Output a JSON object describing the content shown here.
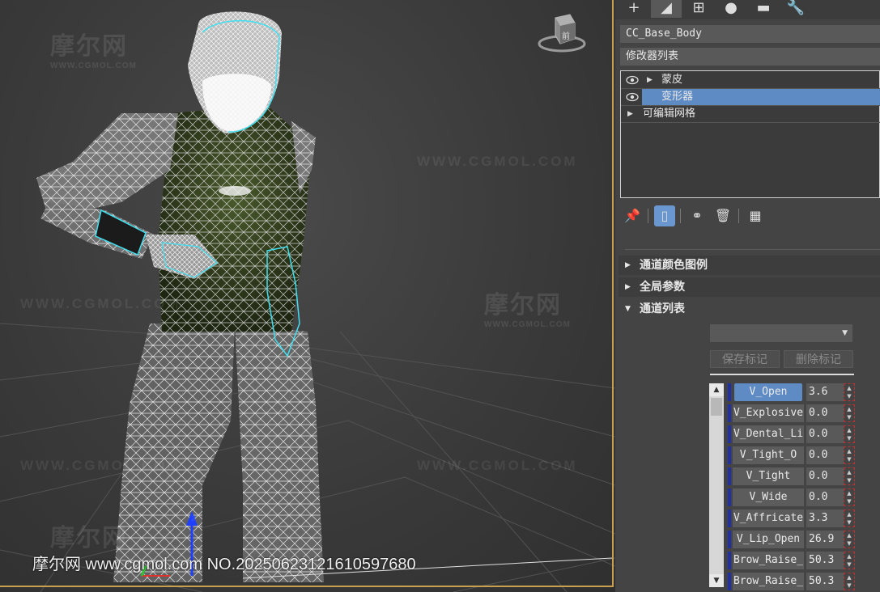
{
  "viewport": {
    "watermarks": [
      {
        "brand": "摩尔网",
        "sub": "WWW.CGMOL.COM"
      },
      {
        "brand": "摩尔网",
        "sub": "WWW.CGMOL.COM"
      },
      {
        "brand": "摩尔网",
        "sub": ""
      }
    ],
    "url_watermarks": [
      "WWW.CGMOL.COM",
      "WWW.CGMOL.COM",
      "WWW.CGMOL.COM",
      "WWW.CGMOL.COM"
    ],
    "footer_watermark": "摩尔网 www.cgmol.com NO.20250623121610597680",
    "viewcube_label": "前"
  },
  "panel": {
    "tabs": [
      {
        "icon": "create-icon",
        "glyph": "+"
      },
      {
        "icon": "modify-icon",
        "glyph": "◢"
      },
      {
        "icon": "hierarchy-icon",
        "glyph": "⊞"
      },
      {
        "icon": "motion-icon",
        "glyph": "●"
      },
      {
        "icon": "display-icon",
        "glyph": "▬"
      },
      {
        "icon": "utilities-icon",
        "glyph": "🔧"
      }
    ],
    "object_name": "CC_Base_Body",
    "modifier_list_label": "修改器列表",
    "stack": [
      {
        "label": "蒙皮",
        "eye": true,
        "expand": true,
        "selected": false
      },
      {
        "label": "变形器",
        "eye": true,
        "expand": false,
        "selected": true
      },
      {
        "label": "可编辑网格",
        "eye": false,
        "expand": true,
        "selected": false
      }
    ],
    "rollouts": [
      {
        "label": "通道颜色图例",
        "open": false
      },
      {
        "label": "全局参数",
        "open": false
      },
      {
        "label": "通道列表",
        "open": true
      }
    ],
    "dropdown_value": "",
    "save_marker_label": "保存标记",
    "delete_marker_label": "删除标记",
    "channels": [
      {
        "name": "V_Open",
        "value": "3.6",
        "selected": true
      },
      {
        "name": "V_Explosive",
        "value": "0.0",
        "selected": false
      },
      {
        "name": "V_Dental_Li",
        "value": "0.0",
        "selected": false
      },
      {
        "name": "V_Tight_O",
        "value": "0.0",
        "selected": false
      },
      {
        "name": "V_Tight",
        "value": "0.0",
        "selected": false
      },
      {
        "name": "V_Wide",
        "value": "0.0",
        "selected": false
      },
      {
        "name": "V_Affricate",
        "value": "3.3",
        "selected": false
      },
      {
        "name": "V_Lip_Open",
        "value": "26.9",
        "selected": false
      },
      {
        "name": "Brow_Raise_",
        "value": "50.3",
        "selected": false
      },
      {
        "name": "Brow_Raise_",
        "value": "50.3",
        "selected": false
      }
    ]
  }
}
